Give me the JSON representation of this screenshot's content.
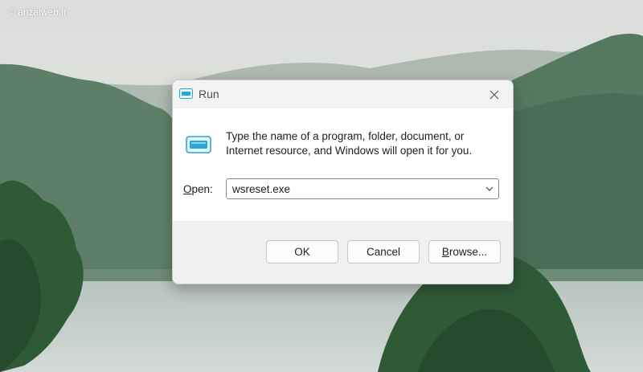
{
  "watermark": "© anzalweb.ir",
  "window": {
    "title": "Run",
    "title_icon": "run-icon",
    "close_icon": "close-icon"
  },
  "content": {
    "description_line1": "Type the name of a program, folder, document, or",
    "description_line2": "Internet resource, and Windows will open it for you.",
    "open_label_accel": "O",
    "open_label_rest": "pen:",
    "open_value": "wsreset.exe",
    "dropdown_icon": "chevron-down-icon"
  },
  "buttons": {
    "ok": "OK",
    "cancel": "Cancel",
    "browse_accel": "B",
    "browse_rest": "rowse..."
  },
  "colors": {
    "accent": "#2aa6d9",
    "sky": "#d9dcd8",
    "forest": "#3f6b4d",
    "lake": "#c6cfcc"
  }
}
